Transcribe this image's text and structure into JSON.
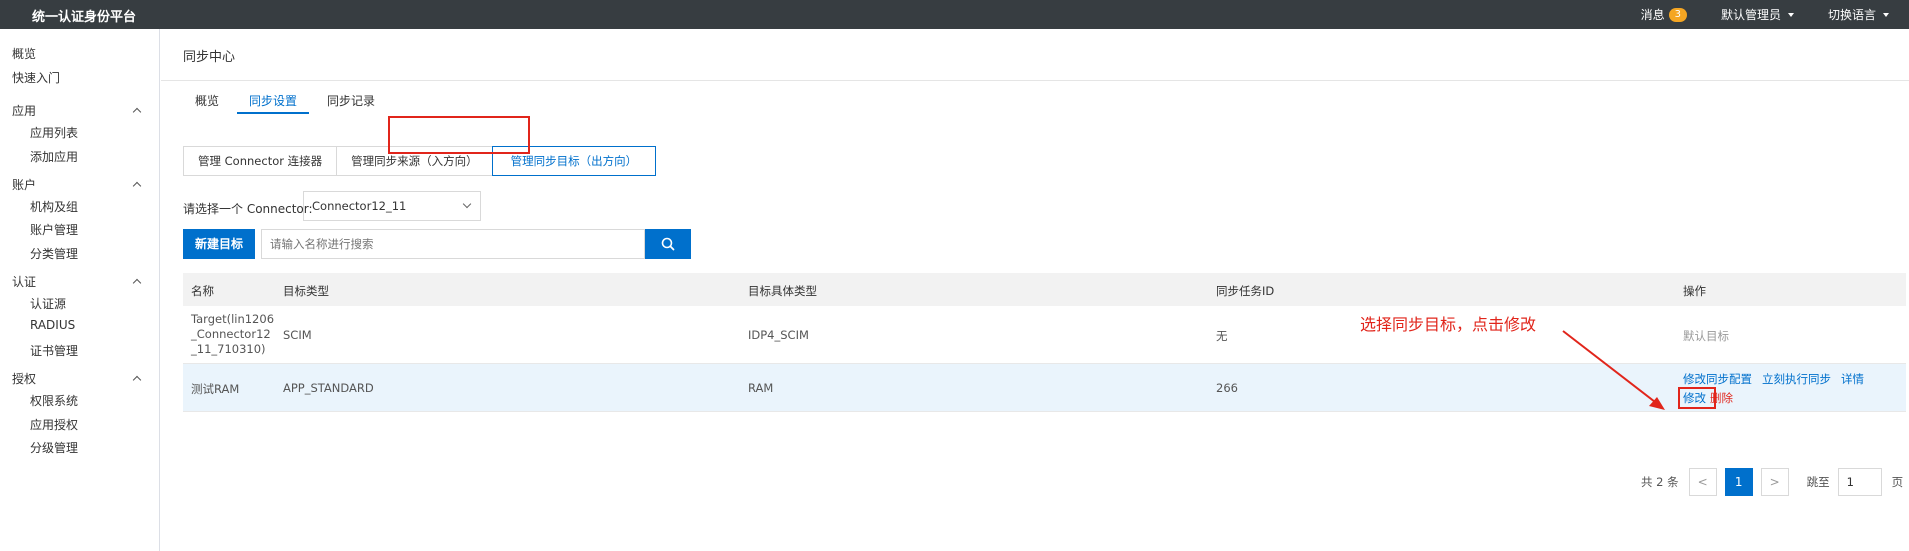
{
  "topbar": {
    "app_title": "统一认证身份平台",
    "messages_label": "消息",
    "messages_count": "3",
    "user_label": "默认管理员",
    "language_label": "切换语言"
  },
  "sidebar": {
    "overview": "概览",
    "quick_start": "快速入门",
    "groups": [
      {
        "label": "应用",
        "items": [
          "应用列表",
          "添加应用"
        ]
      },
      {
        "label": "账户",
        "items": [
          "机构及组",
          "账户管理",
          "分类管理"
        ]
      },
      {
        "label": "认证",
        "items": [
          "认证源",
          "RADIUS",
          "证书管理"
        ]
      },
      {
        "label": "授权",
        "items": [
          "权限系统",
          "应用授权",
          "分级管理"
        ]
      }
    ]
  },
  "main": {
    "page_title": "同步中心",
    "tabs": [
      "概览",
      "同步设置",
      "同步记录"
    ],
    "active_tab": "同步设置",
    "sub_buttons": [
      "管理 Connector 连接器",
      "管理同步来源（入方向）",
      "管理同步目标（出方向）"
    ],
    "connector_label": "请选择一个 Connector:",
    "connector_value": "Connector12_11",
    "new_target_button": "新建目标",
    "search_placeholder": "请输入名称进行搜索",
    "annotation": "选择同步目标，点击修改"
  },
  "table": {
    "headers": [
      "名称",
      "目标类型",
      "目标具体类型",
      "同步任务ID",
      "操作"
    ],
    "rows": [
      {
        "name_lines": [
          "Target(lin1206",
          "_Connector12",
          "_11_710310)"
        ],
        "type": "SCIM",
        "subtype": "IDP4_SCIM",
        "task_id": "无",
        "op_text": "默认目标"
      },
      {
        "name": "测试RAM",
        "type": "APP_STANDARD",
        "subtype": "RAM",
        "task_id": "266",
        "ops": [
          "修改同步配置",
          "立刻执行同步",
          "详情",
          "修改",
          "删除"
        ]
      }
    ]
  },
  "pagination": {
    "total_text": "共 2 条",
    "prev": "<",
    "current_page": "1",
    "next": ">",
    "jump_label": "跳至",
    "jump_value": "1",
    "page_suffix": "页"
  },
  "colors": {
    "topbar_bg": "#373d41",
    "primary": "#0070cc",
    "annotation_red": "#e1251b",
    "badge": "#f5a623"
  }
}
